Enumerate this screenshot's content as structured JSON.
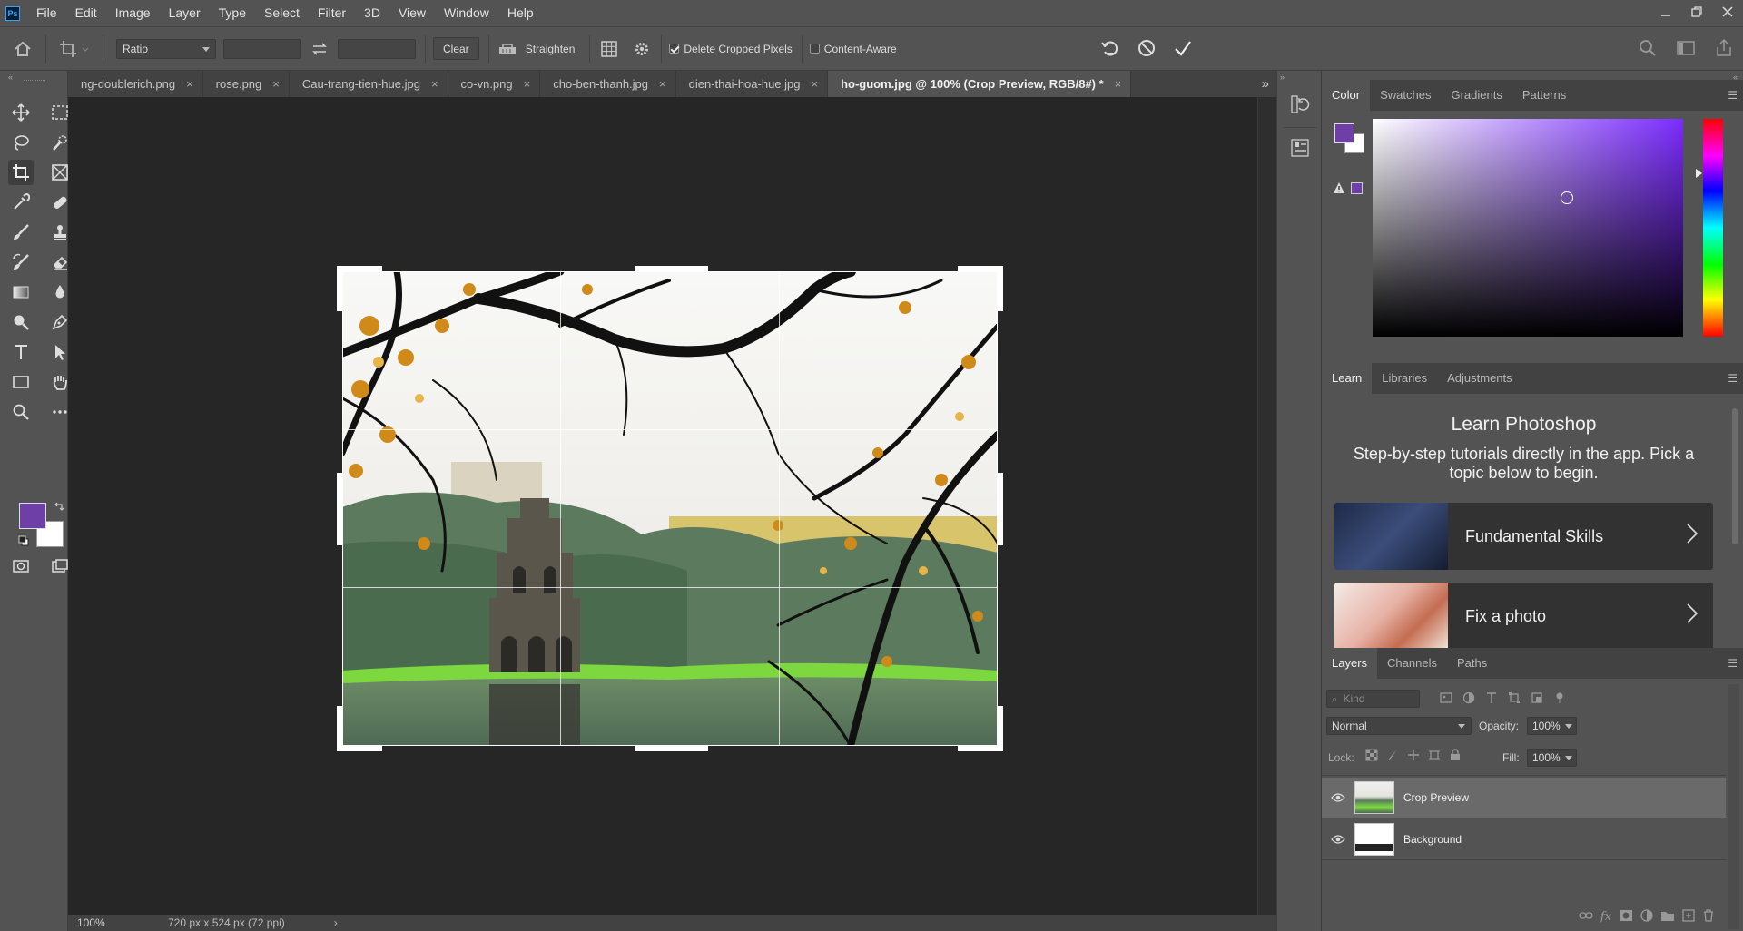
{
  "app": {
    "logo": "Ps"
  },
  "menu": [
    "File",
    "Edit",
    "Image",
    "Layer",
    "Type",
    "Select",
    "Filter",
    "3D",
    "View",
    "Window",
    "Help"
  ],
  "window_controls": [
    "minimize-icon",
    "restore-icon",
    "close-icon"
  ],
  "options": {
    "ratio_value": "Ratio",
    "width_value": "",
    "height_value": "",
    "clear_label": "Clear",
    "straighten_label": "Straighten",
    "delete_cropped_label": "Delete Cropped Pixels",
    "delete_cropped_checked": true,
    "content_aware_label": "Content-Aware",
    "content_aware_checked": false
  },
  "tabs": [
    {
      "label": "ng-doublerich.png",
      "active": false
    },
    {
      "label": "rose.png",
      "active": false
    },
    {
      "label": "Cau-trang-tien-hue.jpg",
      "active": false
    },
    {
      "label": "co-vn.png",
      "active": false
    },
    {
      "label": "cho-ben-thanh.jpg",
      "active": false
    },
    {
      "label": "dien-thai-hoa-hue.jpg",
      "active": false
    },
    {
      "label": "ho-guom.jpg @ 100% (Crop Preview, RGB/8#) *",
      "active": true
    }
  ],
  "tab_close_glyph": "×",
  "status": {
    "zoom": "100%",
    "doc_info": "720 px x 524 px (72 ppi)",
    "arrow": "›"
  },
  "colors": {
    "foreground": "#6f3fa8",
    "background": "#ffffff",
    "picker_hue": "#7b2cff"
  },
  "color_panel": {
    "tabs": [
      "Color",
      "Swatches",
      "Gradients",
      "Patterns"
    ],
    "active": "Color"
  },
  "learn_panel": {
    "tabs": [
      "Learn",
      "Libraries",
      "Adjustments"
    ],
    "active": "Learn",
    "title": "Learn Photoshop",
    "description": "Step-by-step tutorials directly in the app. Pick a topic below to begin.",
    "cards": [
      {
        "label": "Fundamental Skills"
      },
      {
        "label": "Fix a photo"
      }
    ]
  },
  "layers_panel": {
    "tabs": [
      "Layers",
      "Channels",
      "Paths"
    ],
    "active": "Layers",
    "kind_placeholder": "Kind",
    "blend_mode": "Normal",
    "opacity_label": "Opacity:",
    "opacity_value": "100%",
    "lock_label": "Lock:",
    "fill_label": "Fill:",
    "fill_value": "100%",
    "layers": [
      {
        "name": "Crop Preview",
        "selected": true
      },
      {
        "name": "Background",
        "selected": false
      }
    ]
  }
}
